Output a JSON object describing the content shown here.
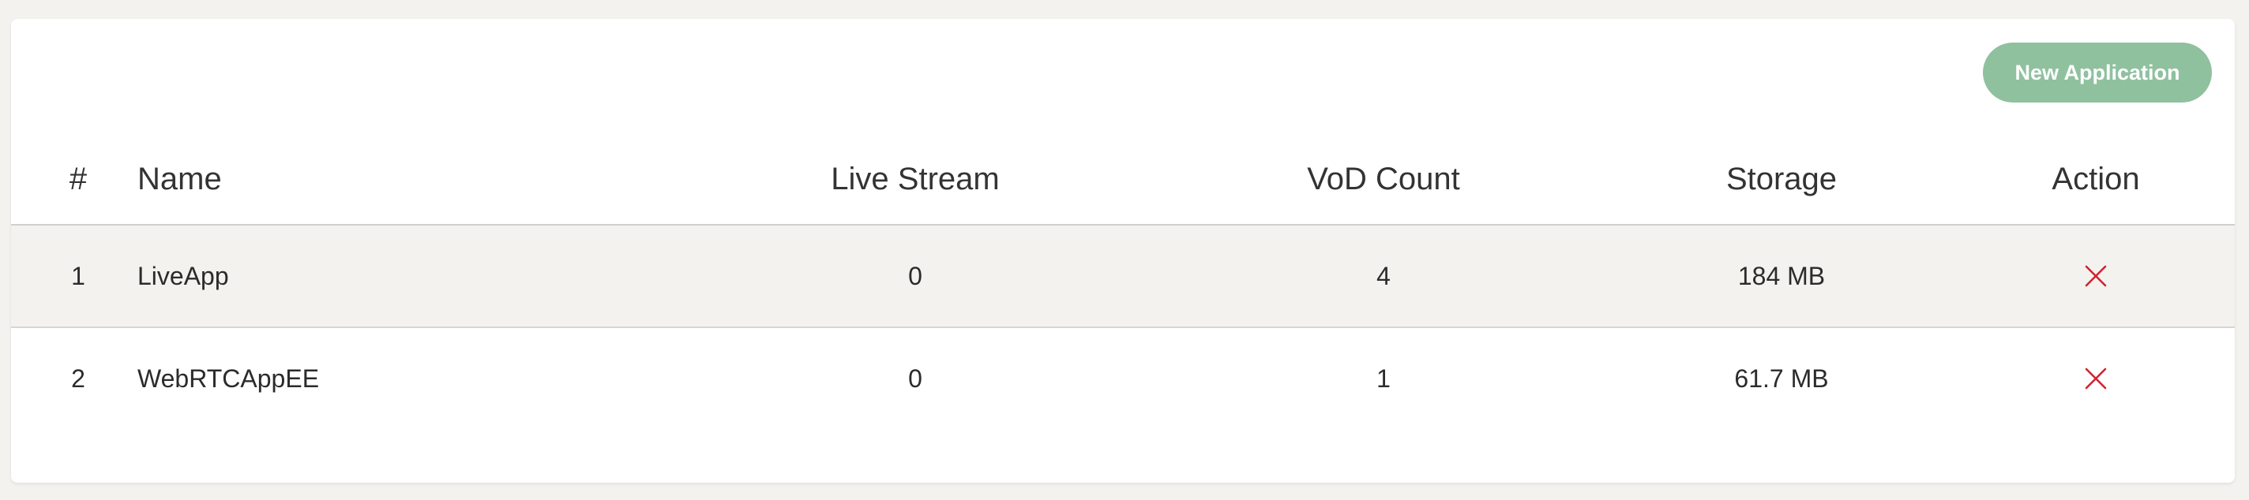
{
  "toolbar": {
    "new_application_label": "New Application"
  },
  "table": {
    "headers": {
      "num": "#",
      "name": "Name",
      "live_stream": "Live Stream",
      "vod_count": "VoD Count",
      "storage": "Storage",
      "action": "Action"
    },
    "rows": [
      {
        "num": "1",
        "name": "LiveApp",
        "live_stream": "0",
        "vod_count": "4",
        "storage": "184 MB"
      },
      {
        "num": "2",
        "name": "WebRTCAppEE",
        "live_stream": "0",
        "vod_count": "1",
        "storage": "61.7 MB"
      }
    ]
  },
  "icons": {
    "delete": "close-icon"
  },
  "colors": {
    "accent": "#8fc19f",
    "delete": "#d0242f",
    "row_shade": "#f3f2ef"
  }
}
